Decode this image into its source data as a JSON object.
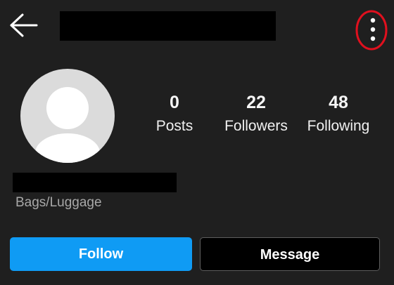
{
  "header": {
    "back_icon": "arrow-left-icon",
    "more_icon": "vertical-ellipsis-icon",
    "highlight_color": "#e0101e"
  },
  "avatar": {
    "icon": "default-avatar-icon"
  },
  "stats": [
    {
      "value": "0",
      "label": "Posts"
    },
    {
      "value": "22",
      "label": "Followers"
    },
    {
      "value": "48",
      "label": "Following"
    }
  ],
  "profile": {
    "category": "Bags/Luggage"
  },
  "actions": {
    "follow_label": "Follow",
    "message_label": "Message",
    "follow_color": "#0f9bf4"
  }
}
